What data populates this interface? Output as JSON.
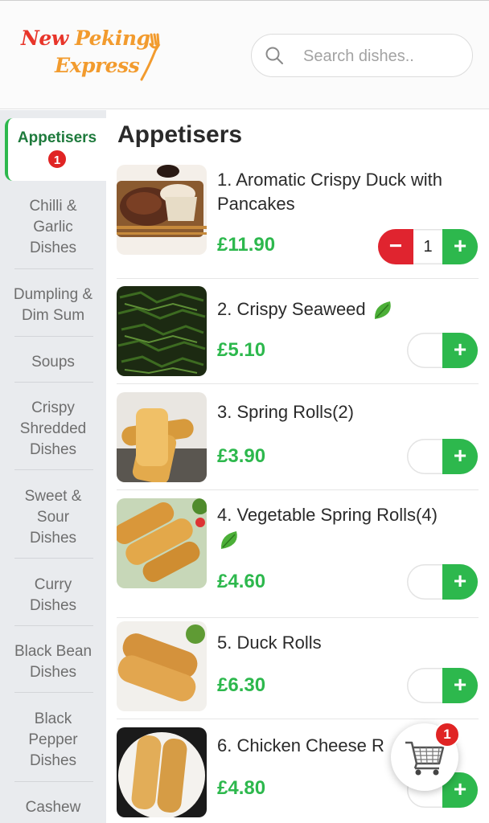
{
  "header": {
    "logo_line1_a": "New",
    "logo_line1_b": "Peking",
    "logo_line2": "Express",
    "search_placeholder": "Search dishes.."
  },
  "sidebar": {
    "items": [
      {
        "label": "Appetisers",
        "badge": "1",
        "active": true
      },
      {
        "label": "Chilli & Garlic Dishes"
      },
      {
        "label": "Dumpling & Dim Sum"
      },
      {
        "label": "Soups"
      },
      {
        "label": "Crispy Shredded Dishes"
      },
      {
        "label": "Sweet & Sour Dishes"
      },
      {
        "label": "Curry Dishes"
      },
      {
        "label": "Black Bean Dishes"
      },
      {
        "label": "Black Pepper Dishes"
      },
      {
        "label": "Cashew"
      }
    ]
  },
  "section": {
    "title": "Appetisers"
  },
  "dishes": [
    {
      "name": "1. Aromatic Crispy Duck with Pancakes",
      "price": "£11.90",
      "qty": "1",
      "vegetarian": false
    },
    {
      "name": "2. Crispy Seaweed",
      "price": "£5.10",
      "vegetarian": true
    },
    {
      "name": "3. Spring Rolls(2)",
      "price": "£3.90",
      "vegetarian": false
    },
    {
      "name": "4. Vegetable Spring Rolls(4)",
      "price": "£4.60",
      "vegetarian": true
    },
    {
      "name": "5. Duck Rolls",
      "price": "£6.30",
      "vegetarian": false
    },
    {
      "name": "6. Chicken Cheese R",
      "price": "£4.80",
      "vegetarian": false
    }
  ],
  "buttons": {
    "minus": "−",
    "plus": "+"
  },
  "cart": {
    "badge": "1",
    "icon": "shopping-cart-icon"
  },
  "colors": {
    "accent_green": "#2db84d",
    "danger_red": "#e0242f",
    "logo_red": "#e8352a",
    "logo_orange": "#f29b2e"
  }
}
